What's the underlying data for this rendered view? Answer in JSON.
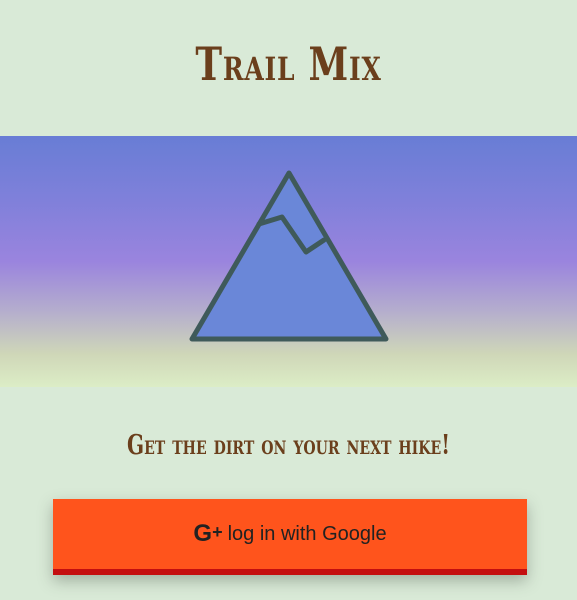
{
  "header": {
    "title": "Trail Mix"
  },
  "hero": {
    "logo_icon": "mountain-icon",
    "colors": {
      "gradient_top": "#687dd5",
      "gradient_middle": "#9a84de",
      "gradient_bottom": "#dcedc6",
      "mountain_fill": "#6a87d8",
      "mountain_stroke": "#3f5a5a"
    }
  },
  "main": {
    "tagline": "Get the dirt on your next hike!"
  },
  "login": {
    "icon": "google-plus-icon",
    "label": "log in with Google",
    "colors": {
      "background": "#ff541c",
      "bottom_border": "#c40e10"
    }
  },
  "theme": {
    "page_background": "#d9ead7",
    "text_brown": "#6b3f1c"
  }
}
